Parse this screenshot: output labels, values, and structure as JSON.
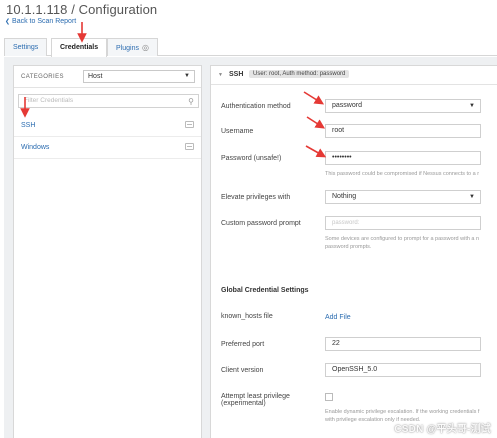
{
  "header": {
    "title": "10.1.1.118 / Configuration",
    "back_label": "Back to Scan Report",
    "back_icon": "chevron-left-icon"
  },
  "tabs": [
    {
      "label": "Settings"
    },
    {
      "label": "Credentials"
    },
    {
      "label": "Plugins"
    }
  ],
  "sidebar": {
    "categories_label": "CATEGORIES",
    "category_value": "Host",
    "filter_placeholder": "Filter Credentials",
    "items": [
      {
        "label": "SSH"
      },
      {
        "label": "Windows"
      }
    ]
  },
  "ssh": {
    "section_name": "SSH",
    "summary": "User: root, Auth method: password",
    "auth_method_label": "Authentication method",
    "auth_method_value": "password",
    "username_label": "Username",
    "username_value": "root",
    "password_label": "Password (unsafe!)",
    "password_value": "••••••••",
    "password_hint": "This password could be compromised if Nessus connects to a r",
    "elevate_label": "Elevate privileges with",
    "elevate_value": "Nothing",
    "custom_prompt_label": "Custom password prompt",
    "custom_prompt_placeholder": "password:",
    "custom_prompt_hint_1": "Some devices are configured to prompt for a password with a n",
    "custom_prompt_hint_2": "password prompts.",
    "global_title": "Global Credential Settings",
    "known_hosts_label": "known_hosts file",
    "known_hosts_link": "Add File",
    "port_label": "Preferred port",
    "port_value": "22",
    "client_label": "Client version",
    "client_value": "OpenSSH_5.0",
    "least_priv_label_1": "Attempt least privilege",
    "least_priv_label_2": "(experimental)",
    "least_priv_hint_1": "Enable dynamic privilege escalation. If the working credentials f",
    "least_priv_hint_2": "with privilege escalation only if needed."
  },
  "watermark": "CSDN @平头哥-测试",
  "colors": {
    "link": "#2b6cb0",
    "annotation_arrow": "#e53935",
    "panel_bg": "#eef0f2"
  }
}
